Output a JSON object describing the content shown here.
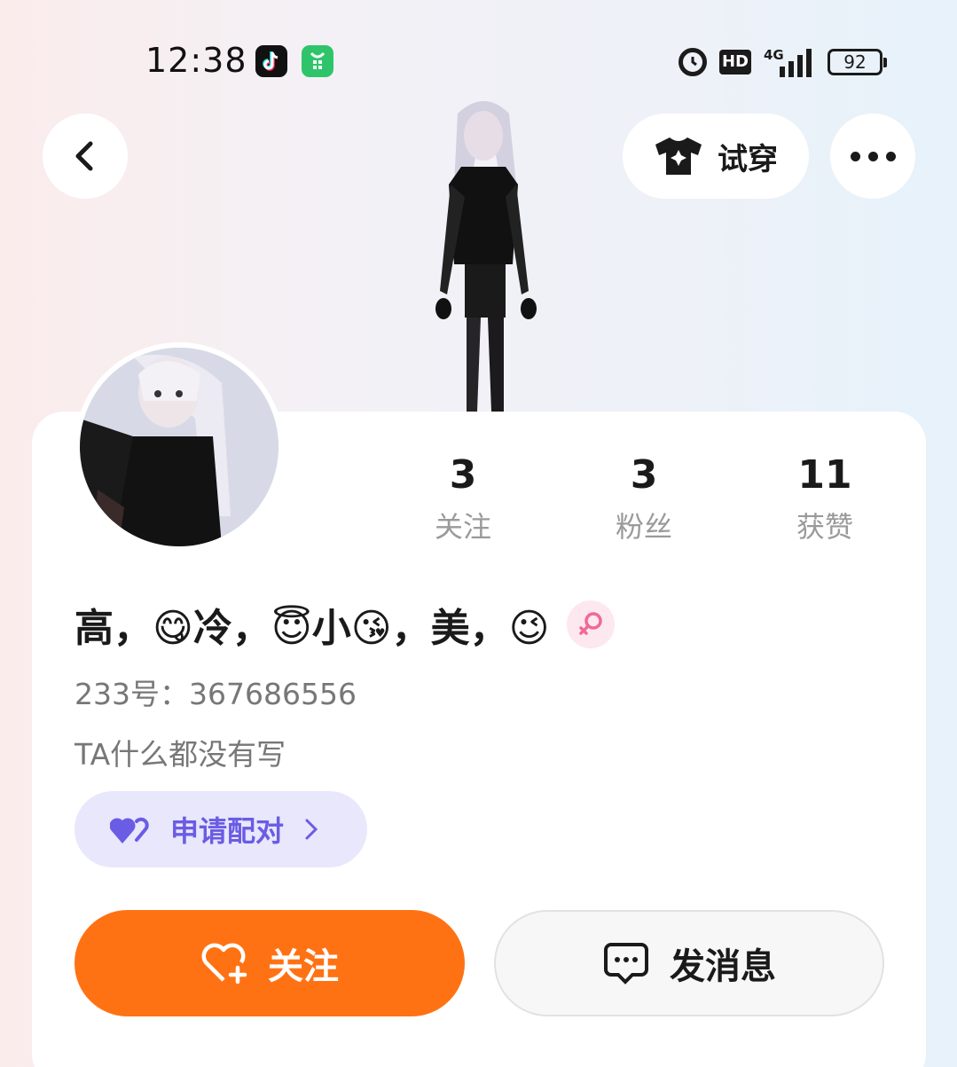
{
  "status_bar": {
    "time": "12:38",
    "hd": "HD",
    "network": "4G",
    "battery": "92",
    "icons": [
      "tiktok-app-icon",
      "green-app-icon",
      "alarm-icon",
      "hd-icon",
      "signal-icon",
      "battery-icon"
    ]
  },
  "nav": {
    "back_icon": "chevron-left-icon",
    "tryon_label": "试穿",
    "tryon_icon": "tshirt-icon",
    "more_icon": "more-dots-icon"
  },
  "profile": {
    "nickname": "高，😋冷，😇小😘，美，😉",
    "gender": "female",
    "uid": "233号：367686556",
    "bio": "TA什么都没有写",
    "stats": [
      {
        "value": "3",
        "label": "关注"
      },
      {
        "value": "3",
        "label": "粉丝"
      },
      {
        "value": "11",
        "label": "获赞"
      }
    ]
  },
  "actions": {
    "pair_label": "申请配对",
    "follow_label": "关注",
    "message_label": "发消息"
  },
  "colors": {
    "accent_orange": "#ff7214",
    "pair_purple": "#6a5ce4",
    "pair_bg": "#e8e7fb",
    "gender_pink": "#f06a95"
  }
}
